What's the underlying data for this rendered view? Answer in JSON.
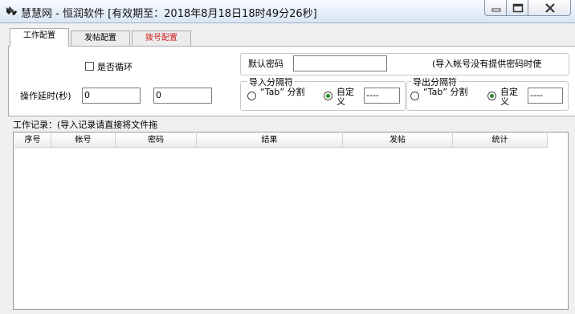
{
  "window": {
    "title": "慧慧网 - 恒润软件 [有效期至：2018年8月18日18时49分26秒]"
  },
  "tabs": [
    {
      "label": "工作配置",
      "active": true
    },
    {
      "label": "发帖配置",
      "active": false
    },
    {
      "label": "拨号配置",
      "active": false,
      "color": "#d01a1a"
    }
  ],
  "config": {
    "loop_label": "是否循环",
    "loop_checked": false,
    "delay_label": "操作延时(秒)",
    "delay_min": "0",
    "delay_max": "0",
    "default_password_label": "默认密码",
    "default_password_value": "",
    "default_password_hint": "(导入帐号没有提供密码时使",
    "import_sep": {
      "title": "导入分隔符",
      "tab_option": "“Tab” 分割",
      "custom_option": "自定义",
      "custom_value": "----",
      "selected": "custom"
    },
    "export_sep": {
      "title": "导出分隔符",
      "tab_option": "“Tab” 分割",
      "custom_option": "自定义",
      "custom_value": "----",
      "selected": "custom"
    }
  },
  "log": {
    "label": "工作记录：(导入记录请直接将文件拖",
    "columns": [
      "序号",
      "帐号",
      "密码",
      "结果",
      "发帖",
      "统计"
    ]
  }
}
